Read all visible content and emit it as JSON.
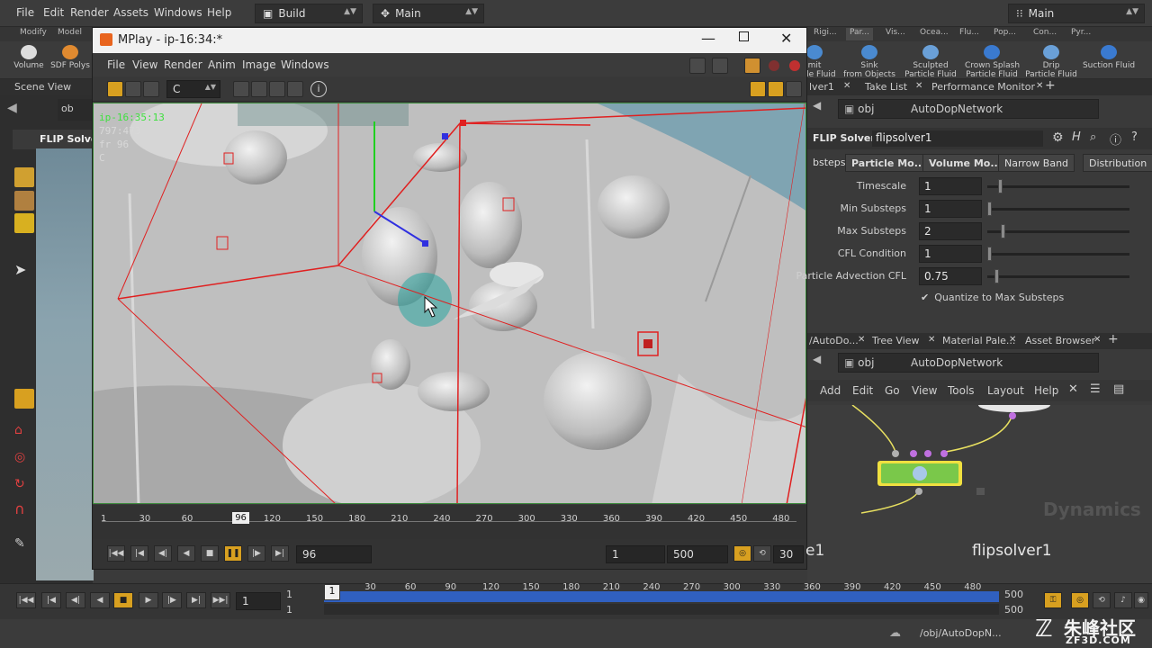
{
  "menubar": {
    "items": [
      "File",
      "Edit",
      "Render",
      "Assets",
      "Windows",
      "Help"
    ],
    "desktop_combo": "Build",
    "context_combo": "Main",
    "right_combo": "Main"
  },
  "shelf_tabs": [
    "Modify",
    "Model",
    "Rigi...",
    "Par...",
    "Vis...",
    "Ocea...",
    "Flu...",
    "Pop...",
    "Con...",
    "Pyr..."
  ],
  "shelf_tools_left": [
    "Volume",
    "SDF Polys"
  ],
  "shelf_tools_right": [
    {
      "label": "mit\nrticle Fluid"
    },
    {
      "label": "Sink\nfrom Objects"
    },
    {
      "label": "Sculpted\nParticle Fluid"
    },
    {
      "label": "Crown Splash\nParticle Fluid"
    },
    {
      "label": "Drip\nParticle Fluid"
    },
    {
      "label": "Suction Fluid"
    }
  ],
  "left_pane": {
    "tab": "Scene View",
    "path_prefix": "ob",
    "flip_solver_label": "FLIP Solve"
  },
  "mplay": {
    "title": "MPlay - ip-16:34:*",
    "menu": [
      "File",
      "View",
      "Render",
      "Anim",
      "Image",
      "Windows"
    ],
    "channel": "C",
    "overlay": {
      "name": "ip-16:35:13",
      "res": "797:473",
      "frame": "fr 96",
      "channel": "C"
    },
    "ruler_ticks": [
      "1",
      "30",
      "60",
      "96",
      "120",
      "150",
      "180",
      "210",
      "240",
      "270",
      "300",
      "330",
      "360",
      "390",
      "420",
      "450",
      "480"
    ],
    "current_frame": "96",
    "range_start": "1",
    "range_end": "500",
    "fps": "30",
    "bg_label": "e1"
  },
  "right_pane": {
    "top_tabs": [
      "lver1",
      "Take List",
      "Performance Monitor"
    ],
    "path": "obj",
    "network": "AutoDopNetwork",
    "node_type": "FLIP Solver",
    "node_name": "flipsolver1",
    "parm_tabs": [
      "bsteps",
      "Particle Mo...",
      "Volume Mo...",
      "Narrow Band",
      "Distribution"
    ],
    "parms": [
      {
        "label": "Timescale",
        "value": "1",
        "slider": 0.08
      },
      {
        "label": "Min Substeps",
        "value": "1",
        "slider": 0.0
      },
      {
        "label": "Max Substeps",
        "value": "2",
        "slider": 0.1
      },
      {
        "label": "CFL Condition",
        "value": "1",
        "slider": 0.0
      },
      {
        "label": "Particle Advection CFL",
        "value": "0.75",
        "slider": 0.05
      }
    ],
    "checkbox_label": "Quantize to Max Substeps",
    "net_tabs": [
      "/AutoDo...",
      "Tree View",
      "Material Pale...",
      "Asset Browser"
    ],
    "net_path": "obj",
    "net_network": "AutoDopNetwork",
    "net_menu": [
      "Add",
      "Edit",
      "Go",
      "View",
      "Tools",
      "Layout",
      "Help"
    ],
    "net_watermark": "Dynamics",
    "node_label": "flipsolver1"
  },
  "main_timeline": {
    "frame_field": "1",
    "start": "1",
    "start2": "1",
    "current": "1",
    "ticks": [
      "30",
      "60",
      "90",
      "120",
      "150",
      "180",
      "210",
      "240",
      "270",
      "300",
      "330",
      "360",
      "390",
      "420",
      "450",
      "480"
    ],
    "end": "500",
    "end2": "500"
  },
  "status": {
    "path": "/obj/AutoDopN...",
    "watermark_cn": "朱峰社区",
    "watermark_url": "ZF3D.COM"
  },
  "colors": {
    "accent_orange": "#e0a020",
    "node_green": "#7ac84a",
    "node_yellow": "#f0e040",
    "bbox_red": "#e02020"
  }
}
